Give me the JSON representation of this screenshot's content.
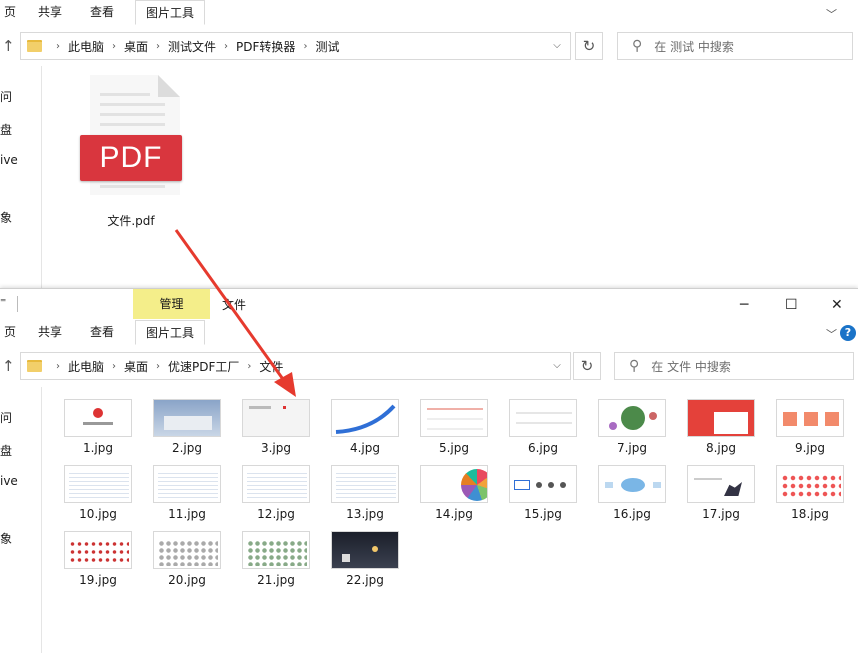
{
  "win1": {
    "tabs": [
      "页",
      "共享",
      "查看",
      "图片工具"
    ],
    "breadcrumb": [
      "此电脑",
      "桌面",
      "测试文件",
      "PDF转换器",
      "测试"
    ],
    "search_placeholder": "在 测试 中搜索",
    "nav_items": [
      "问",
      "盘",
      "ive",
      "象"
    ],
    "file": {
      "name": "文件.pdf",
      "badge": "PDF"
    }
  },
  "win2": {
    "context_tab": "管理",
    "title_tab": "文件",
    "tabs": [
      "页",
      "共享",
      "查看",
      "图片工具"
    ],
    "breadcrumb": [
      "此电脑",
      "桌面",
      "优速PDF工厂",
      "文件"
    ],
    "search_placeholder": "在 文件 中搜索",
    "nav_items": [
      "问",
      "盘",
      "ive",
      "象"
    ],
    "window_controls": {
      "minimize": "─",
      "maximize": "☐",
      "close": "✕"
    },
    "files": [
      "1.jpg",
      "2.jpg",
      "3.jpg",
      "4.jpg",
      "5.jpg",
      "6.jpg",
      "7.jpg",
      "8.jpg",
      "9.jpg",
      "10.jpg",
      "11.jpg",
      "12.jpg",
      "13.jpg",
      "14.jpg",
      "15.jpg",
      "16.jpg",
      "17.jpg",
      "18.jpg",
      "19.jpg",
      "20.jpg",
      "21.jpg",
      "22.jpg"
    ]
  },
  "icons": {
    "up": "up-arrow-icon",
    "folder": "folder-icon",
    "refresh": "refresh-icon",
    "search": "search-icon",
    "help": "help-icon"
  },
  "colors": {
    "pdf_red": "#d9363e",
    "manage_tab": "#f4ee8a",
    "arrow": "#e63a2e",
    "help_blue": "#1a73c8"
  }
}
